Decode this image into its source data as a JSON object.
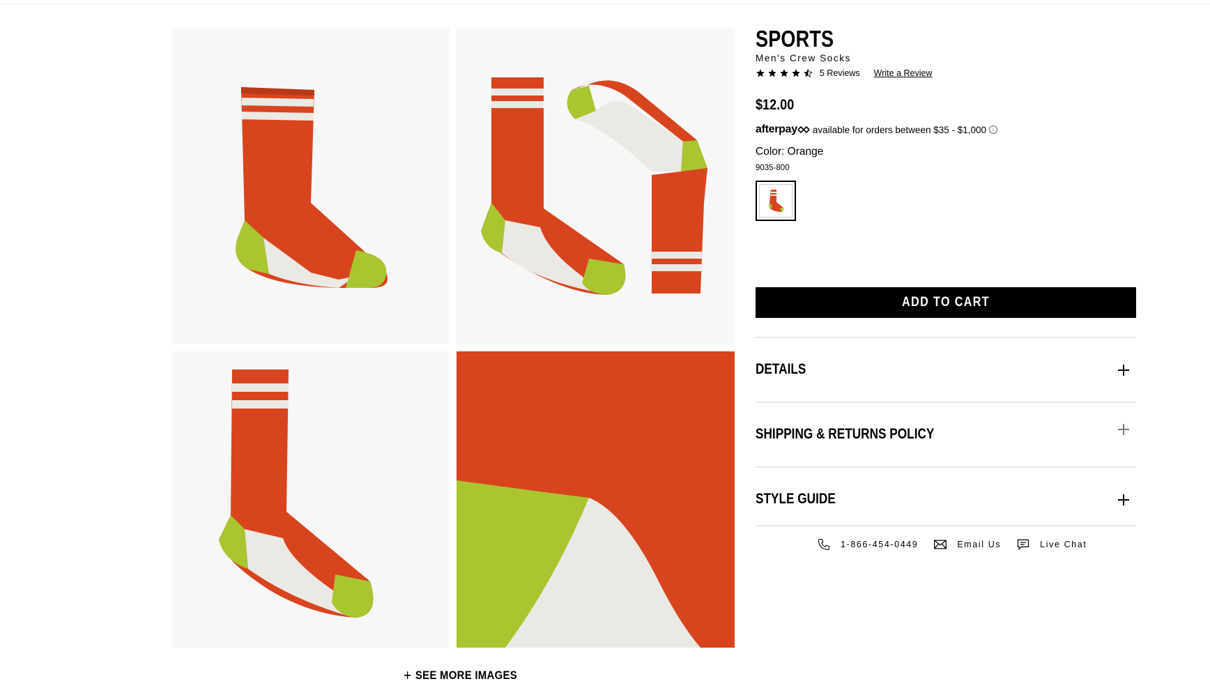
{
  "product": {
    "title": "SPORTS",
    "subtitle": "Men's Crew Socks",
    "rating": 4.5,
    "reviews_label": "5 Reviews",
    "write_review_label": "Write a Review",
    "price": "$12.00",
    "afterpay_logo": "afterpay",
    "afterpay_text": "available for orders between $35 - $1,000",
    "color_label": "Color: Orange",
    "sku": "9035-800",
    "add_to_cart_label": "ADD TO CART"
  },
  "colors": {
    "orange": "#d8441e",
    "lime": "#a9c52f",
    "white": "#ebe9e4",
    "bg": "#f7f7f7"
  },
  "gallery": {
    "images": [
      "sock-side-view",
      "sock-pair-flat",
      "sock-side-flat",
      "sock-fabric-closeup"
    ],
    "see_more_label": "SEE MORE IMAGES"
  },
  "accordion": [
    {
      "label": "DETAILS"
    },
    {
      "label": "SHIPPING & RETURNS POLICY"
    },
    {
      "label": "STYLE GUIDE"
    }
  ],
  "contact": {
    "phone": "1-866-454-0449",
    "email_label": "Email Us",
    "chat_label": "Live Chat",
    "icons": [
      "phone-icon",
      "mail-icon",
      "chat-icon"
    ]
  }
}
